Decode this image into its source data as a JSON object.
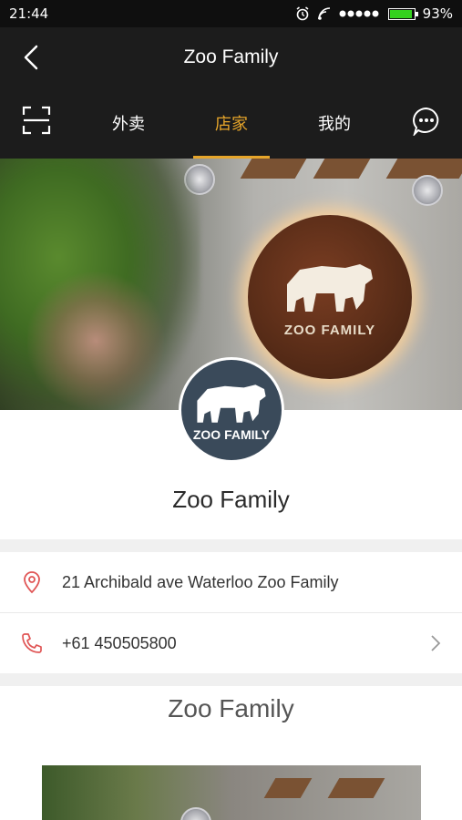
{
  "status_bar": {
    "time": "21:44",
    "battery": "93%",
    "battery_level": 0.93
  },
  "header": {
    "title": "Zoo Family"
  },
  "tabs": [
    {
      "label": "外卖",
      "active": false
    },
    {
      "label": "店家",
      "active": true
    },
    {
      "label": "我的",
      "active": false
    }
  ],
  "banner": {
    "sign_text": "ZOO FAMILY"
  },
  "avatar": {
    "text": "ZOO FAMILY"
  },
  "store": {
    "name": "Zoo Family",
    "address": "21 Archibald ave Waterloo Zoo Family",
    "phone": "+61 450505800"
  },
  "section": {
    "title": "Zoo Family"
  },
  "colors": {
    "accent": "#e6a52a",
    "header_bg": "#1c1c1c",
    "icon_red": "#e05555"
  },
  "icons": [
    "back-icon",
    "scan-icon",
    "chat-icon",
    "location-pin-icon",
    "phone-icon",
    "chevron-right-icon",
    "alarm-icon",
    "wifi-icon",
    "signal-icon",
    "battery-icon",
    "bear-logo-icon"
  ]
}
